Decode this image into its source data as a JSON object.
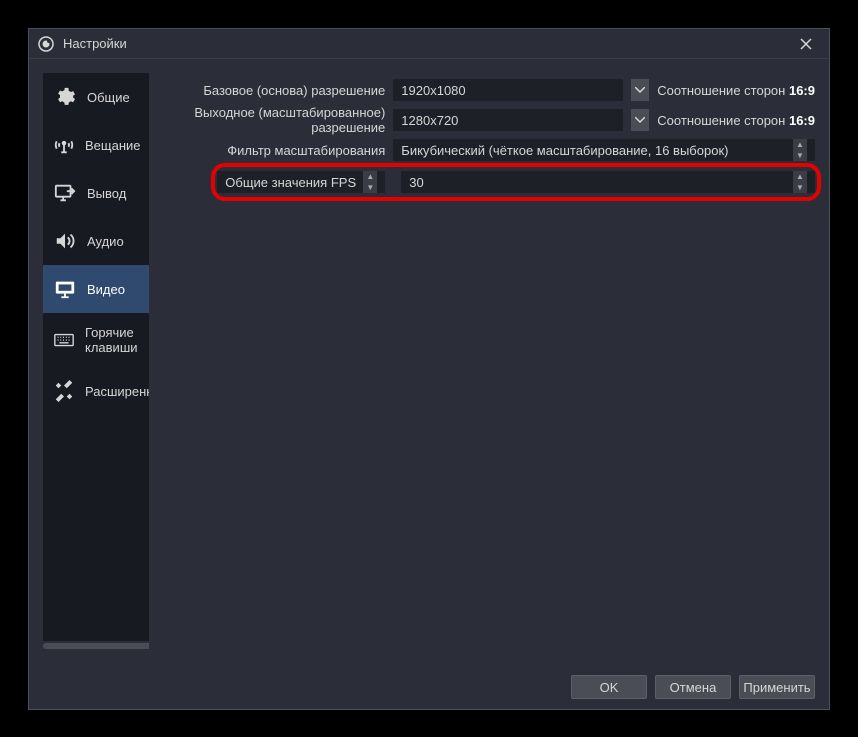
{
  "window": {
    "title": "Настройки"
  },
  "sidebar": {
    "items": [
      {
        "label": "Общие"
      },
      {
        "label": "Вещание"
      },
      {
        "label": "Вывод"
      },
      {
        "label": "Аудио"
      },
      {
        "label": "Видео"
      },
      {
        "label": "Горячие клавиши"
      },
      {
        "label": "Расширенные"
      }
    ],
    "active_index": 4
  },
  "video": {
    "base_res_label": "Базовое (основа) разрешение",
    "base_res_value": "1920x1080",
    "output_res_label": "Выходное (масштабированное) разрешение",
    "output_res_value": "1280x720",
    "aspect_label": "Соотношение сторон",
    "aspect_value": "16:9",
    "filter_label": "Фильтр масштабирования",
    "filter_value": "Бикубический (чёткое масштабирование, 16 выборок)",
    "fps_type_label": "Общие значения FPS",
    "fps_value": "30"
  },
  "footer": {
    "ok": "OK",
    "cancel": "Отмена",
    "apply": "Применить"
  }
}
